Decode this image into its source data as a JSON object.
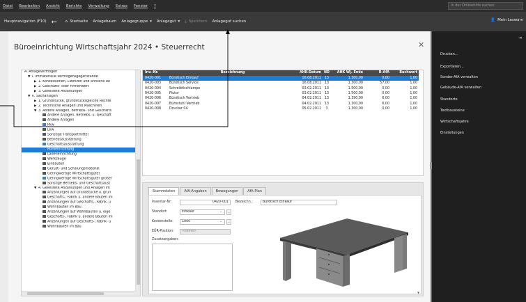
{
  "menu": [
    "Datei",
    "Bearbeiten",
    "Ansicht",
    "Berichte",
    "Verwaltung",
    "Extras",
    "Fenster",
    "?"
  ],
  "online_search_placeholder": "In der Onlinehilfe suchen",
  "toolbar": {
    "hauptnavigation": "Hauptnavigation (F10)",
    "startseite": "Startseite",
    "anlagebaum": "Anlagebaum",
    "anlagegruppe": "Anlagegruppe",
    "anlagegut": "Anlagegut",
    "speichern": "Speichern",
    "anlagegut_suchen": "Anlagegut suchen",
    "mein_konto": "Mein Leswarn"
  },
  "page_title": "Büroeinrichtung  Wirtschaftsjahr  2024 • Steuerrecht",
  "tree": [
    {
      "t": "A. Anlagevermögen",
      "lvl": 0,
      "tg": ""
    },
    {
      "t": "I. Immaterielle Vermögensgegenstände",
      "lvl": 1,
      "tg": "▼"
    },
    {
      "t": "1. Konzessionen, Lizenzen und ähnliche Re",
      "lvl": 2,
      "tg": "▶"
    },
    {
      "t": "2. Geschäfts- oder Firmenwert",
      "lvl": 2,
      "tg": "▶"
    },
    {
      "t": "3. Geleistete Anzahlungen",
      "lvl": 2,
      "tg": "▶"
    },
    {
      "t": "II. Sachanlagen",
      "lvl": 1,
      "tg": "▼"
    },
    {
      "t": "1. Grundstücke, grundstücksgleiche Rechte",
      "lvl": 2,
      "tg": "▶"
    },
    {
      "t": "2. Technische Anlagen und Maschinen",
      "lvl": 2,
      "tg": "▶"
    },
    {
      "t": "3. Andere Anlagen, Betriebs- und Geschäfts",
      "lvl": 2,
      "tg": "▼"
    },
    {
      "t": "Andere Anlagen, Betriebs- u. Geschäft",
      "lvl": 3,
      "ic": "d"
    },
    {
      "t": "Andere Anlagen",
      "lvl": 3,
      "ic": "d"
    },
    {
      "t": "Pkw",
      "lvl": 3,
      "ic": "b"
    },
    {
      "t": "Lkw",
      "lvl": 3,
      "ic": "d"
    },
    {
      "t": "Sonstige Transportmittel",
      "lvl": 3,
      "ic": "d"
    },
    {
      "t": "Betriebsausstattung",
      "lvl": 3,
      "ic": "d"
    },
    {
      "t": "Geschäftsausstattung",
      "lvl": 3,
      "ic": "b"
    },
    {
      "t": "Büroeinrichtung",
      "lvl": 3,
      "ic": "b",
      "sel": true
    },
    {
      "t": "Ladeneinrichtung",
      "lvl": 3,
      "ic": "d"
    },
    {
      "t": "Werkzeuge",
      "lvl": 3,
      "ic": "d"
    },
    {
      "t": "Einbauten",
      "lvl": 3,
      "ic": "d"
    },
    {
      "t": "Gerüst- und Schalungsmaterial",
      "lvl": 3,
      "ic": "d"
    },
    {
      "t": "Geringwertige Wirtschaftsgüter",
      "lvl": 3,
      "ic": "d"
    },
    {
      "t": "Geringwertige Wirtschaftsgüter größer",
      "lvl": 3,
      "ic": "b"
    },
    {
      "t": "Sonstige Betriebs- und Geschäftsaust",
      "lvl": 3,
      "ic": "d"
    },
    {
      "t": "4. Geleistete Anzahlungen und Anlagen im",
      "lvl": 2,
      "tg": "▼"
    },
    {
      "t": "Anzahlungen auf Grundstücke u. grun",
      "lvl": 3,
      "ic": "d"
    },
    {
      "t": "Geschäfts-, Fabrik u. andere Bauten im",
      "lvl": 3,
      "ic": "d"
    },
    {
      "t": "Anzahlungen auf Geschäfts-, Fabrik- u",
      "lvl": 3,
      "ic": "d"
    },
    {
      "t": "Wohnbauten im Bau",
      "lvl": 3,
      "ic": "d"
    },
    {
      "t": "Anzahlungen auf Wohnbauten u. eige",
      "lvl": 3,
      "ic": "d"
    },
    {
      "t": "Geschäfts-, Fabrik u. andere Bauten im",
      "lvl": 3,
      "ic": "d"
    },
    {
      "t": "Anzahlungen auf Geschäfts-, Fabrik- u",
      "lvl": 3,
      "ic": "d"
    },
    {
      "t": "Wohnbauten im Bau",
      "lvl": 3,
      "ic": "d"
    }
  ],
  "grid": {
    "headers": [
      "Inv.-Nr.",
      "Bezeichnung",
      "AHK-Datum",
      "ND",
      "AHK Wj.-Ende",
      "R-AfA",
      "Buchwert"
    ],
    "rows": [
      [
        "0420-001",
        "Bürotisch Einkauf",
        "16.08.2011",
        "13",
        "1.300,00",
        "0,00",
        "1,00"
      ],
      [
        "0420-003",
        "Bürotisch Service",
        "16.08.2011",
        "13",
        "1.300,00",
        "57,00",
        "1,00"
      ],
      [
        "0420-004",
        "Schreibtischlampe",
        "03.02.2011",
        "13",
        "1.500,00",
        "0,00",
        "1,00"
      ],
      [
        "0420-005",
        "Flutor",
        "03.02.2011",
        "13",
        "1.500,00",
        "0,00",
        "1,00"
      ],
      [
        "0420-006",
        "Bürotisch Vertrieb",
        "04.02.2011",
        "13",
        "1.390,00",
        "6,00",
        "1,00"
      ],
      [
        "0420-007",
        "Bürostuhl Vertrieb",
        "04.02.2011",
        "13",
        "1.300,00",
        "6,00",
        "1,00"
      ],
      [
        "0420-008",
        "Drucker 04",
        "05.02.2011",
        "3",
        "1.300,00",
        "0,00",
        "1,00"
      ]
    ]
  },
  "detail": {
    "tabs": [
      "Stammdaten",
      "AfA-Angaben",
      "Bewegungen",
      "AfA-Plan"
    ],
    "inventar_label": "Inventar-Nr:",
    "inventar_value": "0420-001",
    "bezeichnung_label": "Bezeichn.:",
    "bezeichnung_value": "Bürotisch Einkauf",
    "standort_label": "Standort:",
    "standort_value": "Einkauf",
    "kostenstelle_label": "Kostenstelle:",
    "kostenstelle_value": "1000",
    "eur_label": "EÜR-Position:",
    "eur_value": "<keine>",
    "zusatz_label": "Zusatzangaben:"
  },
  "right_menu": [
    "Drucken...",
    "Exportieren...",
    "Sonder-AfA verwalten",
    "Gebäude-AfA verwalten",
    "Standorte",
    "Textbausteine",
    "Wirtschaftsjahre",
    "Einstellungen"
  ]
}
